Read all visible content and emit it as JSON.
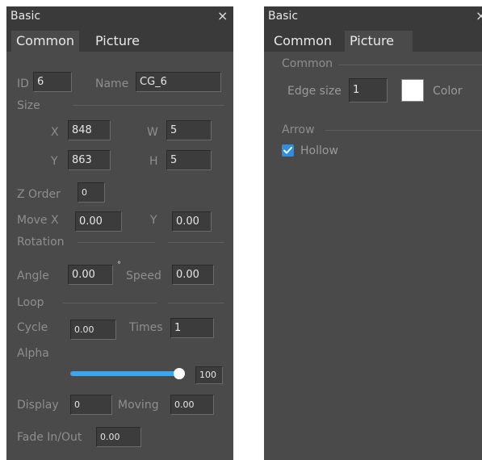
{
  "panel_left": {
    "title": "Basic",
    "close_glyph": "×",
    "tabs": [
      {
        "label": "Common",
        "active": true
      },
      {
        "label": "Picture",
        "active": false
      }
    ],
    "id": {
      "label": "ID",
      "value": "6"
    },
    "name": {
      "label": "Name",
      "value": "CG_6"
    },
    "size": {
      "section": "Size",
      "x_label": "X",
      "x_value": "848",
      "w_label": "W",
      "w_value": "5",
      "y_label": "Y",
      "y_value": "863",
      "h_label": "H",
      "h_value": "5"
    },
    "z_order": {
      "label": "Z Order",
      "value": "0"
    },
    "move": {
      "label": "Move X",
      "x_value": "0.00",
      "y_label": "Y",
      "y_value": "0.00"
    },
    "rotation": {
      "section": "Rotation",
      "angle_label": "Angle",
      "angle_value": "0.00",
      "degree": "°",
      "speed_label": "Speed",
      "speed_value": "0.00"
    },
    "loop": {
      "section": "Loop",
      "cycle_label": "Cycle",
      "cycle_value": "0.00",
      "times_label": "Times",
      "times_value": "1"
    },
    "alpha": {
      "label": "Alpha",
      "value": "100",
      "level_percent": 100
    },
    "display": {
      "label": "Display",
      "value": "0",
      "moving_label": "Moving",
      "moving_value": "0.00"
    },
    "fade": {
      "label": "Fade In/Out",
      "value": "0.00"
    },
    "colors": {
      "panel": "#4a4a4a",
      "header": "#3a3a3a",
      "accent": "#3aa6ef"
    }
  },
  "panel_right": {
    "title": "Basic",
    "close_glyph": "×",
    "tabs": [
      {
        "label": "Common",
        "active": false
      },
      {
        "label": "Picture",
        "active": true
      }
    ],
    "common": {
      "section": "Common",
      "edge_label": "Edge size",
      "edge_value": "1",
      "color_label": "Color",
      "color_value": "#ffffff"
    },
    "arrow": {
      "section": "Arrow",
      "hollow_label": "Hollow",
      "hollow_checked": true
    }
  }
}
